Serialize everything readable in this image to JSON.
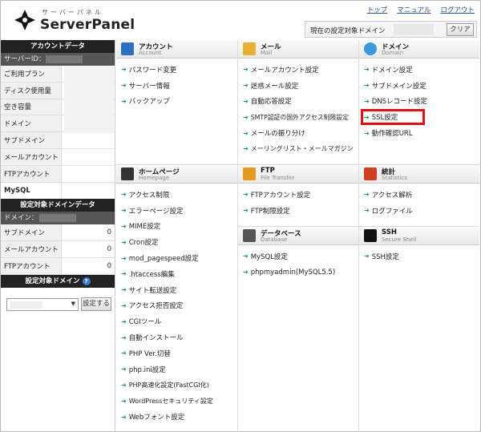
{
  "header": {
    "logo_kana": "サーバーパネル",
    "logo_text": "ServerPanel",
    "links": [
      "トップ",
      "マニュアル",
      "ログアウト"
    ],
    "domain_label": "現在の設定対象ドメイン",
    "clear_button": "クリア"
  },
  "sidebar": {
    "account_title": "アカウントデータ",
    "server_id_label": "サーバーID：",
    "account_rows": [
      {
        "label": "ご利用プラン"
      },
      {
        "label": "ディスク使用量"
      },
      {
        "label": "空き容量"
      },
      {
        "label": "ドメイン"
      },
      {
        "label": "サブドメイン"
      },
      {
        "label": "メールアカウント"
      },
      {
        "label": "FTPアカウント"
      },
      {
        "label": "MySQL"
      }
    ],
    "domain_data_title": "設定対象ドメインデータ",
    "domain_label": "ドメイン：",
    "domain_rows": [
      {
        "label": "サブドメイン",
        "value": "0"
      },
      {
        "label": "メールアカウント",
        "value": "0"
      },
      {
        "label": "FTPアカウント",
        "value": "0"
      }
    ],
    "domain_select_title": "設定対象ドメイン",
    "help_icon": "?",
    "set_button": "設定する"
  },
  "panels": {
    "account": {
      "title": "アカウント",
      "subtitle": "Account",
      "icon": "person-icon",
      "items": [
        "パスワード変更",
        "サーバー情報",
        "バックアップ"
      ]
    },
    "mail": {
      "title": "メール",
      "subtitle": "Mail",
      "icon": "envelope-icon",
      "items": [
        "メールアカウント設定",
        "迷惑メール設定",
        "自動応答設定",
        "SMTP認証の国外アクセス制限設定",
        "メールの振り分け",
        "メーリングリスト・メールマガジン"
      ]
    },
    "domain": {
      "title": "ドメイン",
      "subtitle": "Domain",
      "icon": "globe-icon",
      "items": [
        "ドメイン設定",
        "サブドメイン設定",
        "DNSレコード設定",
        "SSL設定",
        "動作確認URL"
      ]
    },
    "homepage": {
      "title": "ホームページ",
      "subtitle": "Homepage",
      "icon": "homepage-icon",
      "items": [
        "アクセス制限",
        "エラーページ設定",
        "MIME設定",
        "Cron設定",
        "mod_pagespeed設定",
        ".htaccess編集",
        "サイト転送設定",
        "アクセス拒否設定",
        "CGIツール",
        "自動インストール",
        "PHP Ver.切替",
        "php.ini設定",
        "PHP高速化設定(FastCGI化)",
        "WordPressセキュリティ設定",
        "Webフォント設定"
      ]
    },
    "ftp": {
      "title": "FTP",
      "subtitle": "File Transfer",
      "icon": "folder-icon",
      "items": [
        "FTPアカウント設定",
        "FTP制限設定"
      ]
    },
    "stats": {
      "title": "統計",
      "subtitle": "Statistics",
      "icon": "bar-chart-icon",
      "items": [
        "アクセス解析",
        "ログファイル"
      ]
    },
    "database": {
      "title": "データベース",
      "subtitle": "Database",
      "icon": "database-icon",
      "items": [
        "MySQL設定",
        "phpmyadmin(MySQL5.5)"
      ]
    },
    "ssh": {
      "title": "SSH",
      "subtitle": "Secure Shell",
      "icon": "terminal-icon",
      "items": [
        "SSH設定"
      ]
    }
  },
  "colors": {
    "accent_link": "#2a50a0",
    "arrow": "#2a9a3a",
    "highlight": "#e01010"
  }
}
